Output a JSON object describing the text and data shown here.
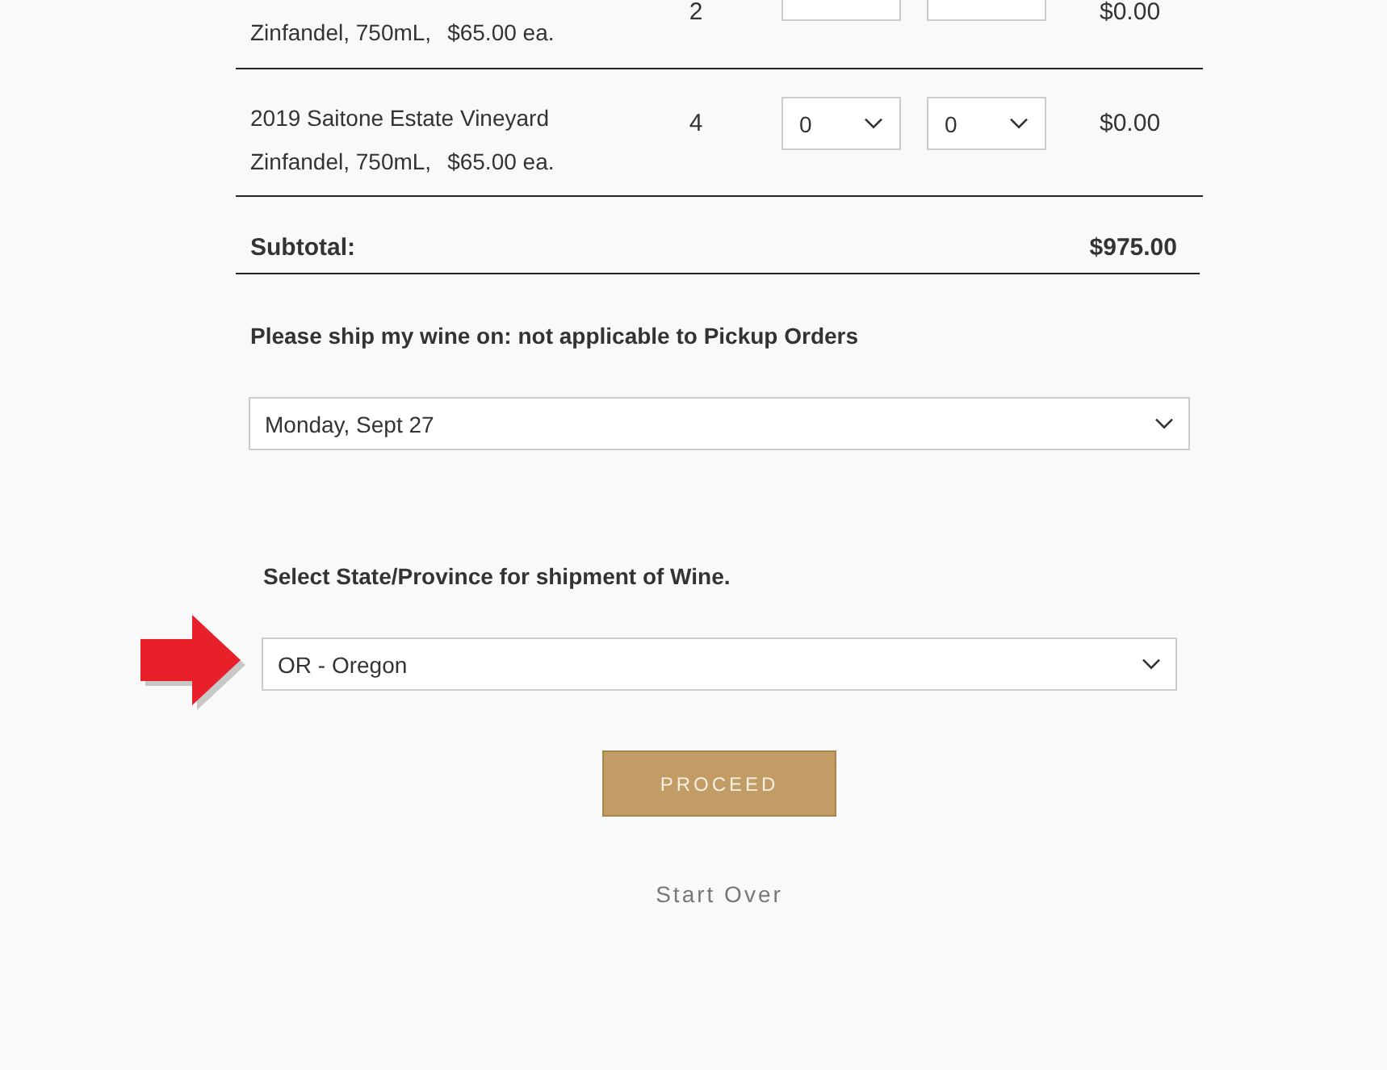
{
  "cart": {
    "rows": [
      {
        "kind": "clipped",
        "details": "Zinfandel, 750mL,",
        "unit_price": "$65.00 ea.",
        "quantity": "2",
        "selects": [
          {
            "kind": "clipped"
          },
          {
            "kind": "clipped"
          }
        ],
        "total": "$0.00"
      },
      {
        "kind": "full",
        "name": "2019 Saitone Estate Vineyard",
        "details": "Zinfandel, 750mL,",
        "unit_price": "$65.00 ea.",
        "quantity": "4",
        "selects": [
          {
            "kind": "full",
            "value": "0"
          },
          {
            "kind": "full",
            "value": "0"
          }
        ],
        "total": "$0.00"
      }
    ],
    "subtotal": {
      "label": "Subtotal:",
      "value": "$975.00"
    }
  },
  "ship_date": {
    "label": "Please ship my wine on: not applicable to Pickup Orders",
    "value": "Monday, Sept 27"
  },
  "shipping_state": {
    "label": "Select State/Province for shipment of Wine.",
    "value": "OR - Oregon"
  },
  "buttons": {
    "proceed": "PROCEED",
    "start_over": "Start Over"
  }
}
